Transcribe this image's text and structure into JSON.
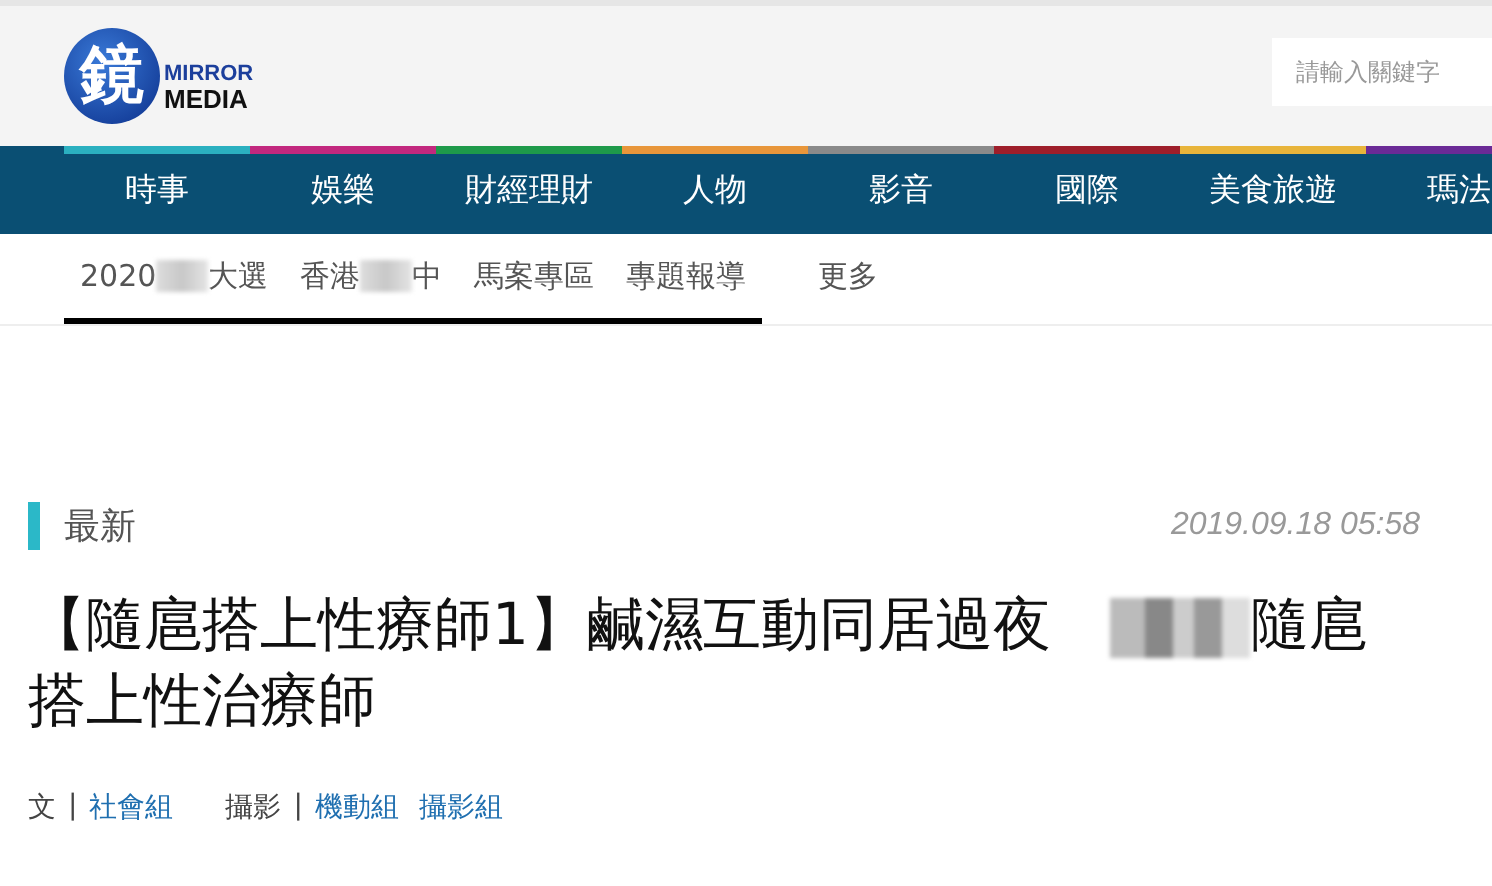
{
  "header": {
    "logo": {
      "glyph": "鏡",
      "word_1": "MIRROR",
      "word_2": "MEDIA"
    },
    "search": {
      "placeholder": "請輸入關鍵字"
    }
  },
  "nav": [
    {
      "label": "時事",
      "color": "#2bb0c0"
    },
    {
      "label": "娛樂",
      "color": "#c2287e"
    },
    {
      "label": "財經理財",
      "color": "#1e9a4a"
    },
    {
      "label": "人物",
      "color": "#e8963a"
    },
    {
      "label": "影音",
      "color": "#8a8a8a"
    },
    {
      "label": "國際",
      "color": "#9e1e2a"
    },
    {
      "label": "美食旅遊",
      "color": "#e8b43a"
    },
    {
      "label": "瑪法",
      "color": "#6a2a96"
    }
  ],
  "subnav": [
    {
      "before": "2020",
      "after": "大選",
      "redacted": true,
      "underlined": true
    },
    {
      "before": "香港",
      "after": "中",
      "redacted": true,
      "underlined": true
    },
    {
      "before": "馬案專區",
      "redacted": false,
      "underlined": true
    },
    {
      "before": "專題報導",
      "redacted": false,
      "underlined": true
    },
    {
      "before": "更多",
      "redacted": false,
      "underlined": false
    }
  ],
  "article": {
    "section": "最新",
    "date": "2019.09.18 05:58",
    "title_before": "【隨扈搭上性療師1】鹹濕互動同居過夜",
    "title_redacted": true,
    "title_after": "隨扈搭上性治療師",
    "byline": [
      {
        "role": "文",
        "separator": "|",
        "names": [
          "社會組"
        ]
      },
      {
        "role": "攝影",
        "separator": "|",
        "names": [
          "機動組",
          "攝影組"
        ]
      }
    ]
  }
}
